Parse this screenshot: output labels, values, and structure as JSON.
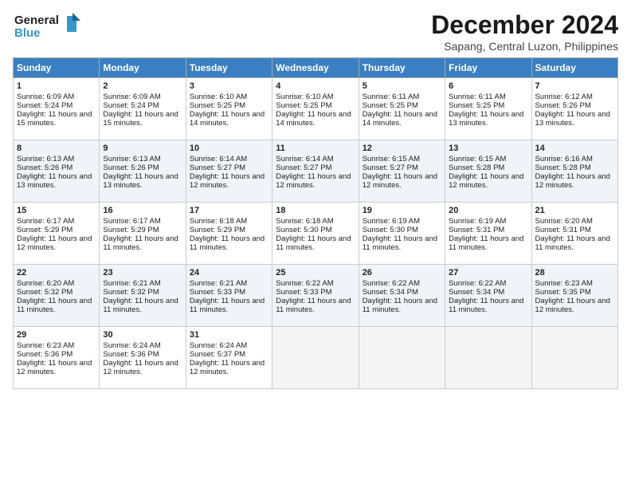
{
  "logo": {
    "line1": "General",
    "line2": "Blue"
  },
  "title": "December 2024",
  "subtitle": "Sapang, Central Luzon, Philippines",
  "days_of_week": [
    "Sunday",
    "Monday",
    "Tuesday",
    "Wednesday",
    "Thursday",
    "Friday",
    "Saturday"
  ],
  "weeks": [
    [
      {
        "day": "1",
        "sunrise": "6:09 AM",
        "sunset": "5:24 PM",
        "daylight": "11 hours and 15 minutes."
      },
      {
        "day": "2",
        "sunrise": "6:09 AM",
        "sunset": "5:24 PM",
        "daylight": "11 hours and 15 minutes."
      },
      {
        "day": "3",
        "sunrise": "6:10 AM",
        "sunset": "5:25 PM",
        "daylight": "11 hours and 14 minutes."
      },
      {
        "day": "4",
        "sunrise": "6:10 AM",
        "sunset": "5:25 PM",
        "daylight": "11 hours and 14 minutes."
      },
      {
        "day": "5",
        "sunrise": "6:11 AM",
        "sunset": "5:25 PM",
        "daylight": "11 hours and 14 minutes."
      },
      {
        "day": "6",
        "sunrise": "6:11 AM",
        "sunset": "5:25 PM",
        "daylight": "11 hours and 13 minutes."
      },
      {
        "day": "7",
        "sunrise": "6:12 AM",
        "sunset": "5:26 PM",
        "daylight": "11 hours and 13 minutes."
      }
    ],
    [
      {
        "day": "8",
        "sunrise": "6:13 AM",
        "sunset": "5:26 PM",
        "daylight": "11 hours and 13 minutes."
      },
      {
        "day": "9",
        "sunrise": "6:13 AM",
        "sunset": "5:26 PM",
        "daylight": "11 hours and 13 minutes."
      },
      {
        "day": "10",
        "sunrise": "6:14 AM",
        "sunset": "5:27 PM",
        "daylight": "11 hours and 12 minutes."
      },
      {
        "day": "11",
        "sunrise": "6:14 AM",
        "sunset": "5:27 PM",
        "daylight": "11 hours and 12 minutes."
      },
      {
        "day": "12",
        "sunrise": "6:15 AM",
        "sunset": "5:27 PM",
        "daylight": "11 hours and 12 minutes."
      },
      {
        "day": "13",
        "sunrise": "6:15 AM",
        "sunset": "5:28 PM",
        "daylight": "11 hours and 12 minutes."
      },
      {
        "day": "14",
        "sunrise": "6:16 AM",
        "sunset": "5:28 PM",
        "daylight": "11 hours and 12 minutes."
      }
    ],
    [
      {
        "day": "15",
        "sunrise": "6:17 AM",
        "sunset": "5:29 PM",
        "daylight": "11 hours and 12 minutes."
      },
      {
        "day": "16",
        "sunrise": "6:17 AM",
        "sunset": "5:29 PM",
        "daylight": "11 hours and 11 minutes."
      },
      {
        "day": "17",
        "sunrise": "6:18 AM",
        "sunset": "5:29 PM",
        "daylight": "11 hours and 11 minutes."
      },
      {
        "day": "18",
        "sunrise": "6:18 AM",
        "sunset": "5:30 PM",
        "daylight": "11 hours and 11 minutes."
      },
      {
        "day": "19",
        "sunrise": "6:19 AM",
        "sunset": "5:30 PM",
        "daylight": "11 hours and 11 minutes."
      },
      {
        "day": "20",
        "sunrise": "6:19 AM",
        "sunset": "5:31 PM",
        "daylight": "11 hours and 11 minutes."
      },
      {
        "day": "21",
        "sunrise": "6:20 AM",
        "sunset": "5:31 PM",
        "daylight": "11 hours and 11 minutes."
      }
    ],
    [
      {
        "day": "22",
        "sunrise": "6:20 AM",
        "sunset": "5:32 PM",
        "daylight": "11 hours and 11 minutes."
      },
      {
        "day": "23",
        "sunrise": "6:21 AM",
        "sunset": "5:32 PM",
        "daylight": "11 hours and 11 minutes."
      },
      {
        "day": "24",
        "sunrise": "6:21 AM",
        "sunset": "5:33 PM",
        "daylight": "11 hours and 11 minutes."
      },
      {
        "day": "25",
        "sunrise": "6:22 AM",
        "sunset": "5:33 PM",
        "daylight": "11 hours and 11 minutes."
      },
      {
        "day": "26",
        "sunrise": "6:22 AM",
        "sunset": "5:34 PM",
        "daylight": "11 hours and 11 minutes."
      },
      {
        "day": "27",
        "sunrise": "6:22 AM",
        "sunset": "5:34 PM",
        "daylight": "11 hours and 11 minutes."
      },
      {
        "day": "28",
        "sunrise": "6:23 AM",
        "sunset": "5:35 PM",
        "daylight": "11 hours and 12 minutes."
      }
    ],
    [
      {
        "day": "29",
        "sunrise": "6:23 AM",
        "sunset": "5:36 PM",
        "daylight": "11 hours and 12 minutes."
      },
      {
        "day": "30",
        "sunrise": "6:24 AM",
        "sunset": "5:36 PM",
        "daylight": "11 hours and 12 minutes."
      },
      {
        "day": "31",
        "sunrise": "6:24 AM",
        "sunset": "5:37 PM",
        "daylight": "11 hours and 12 minutes."
      },
      null,
      null,
      null,
      null
    ]
  ]
}
